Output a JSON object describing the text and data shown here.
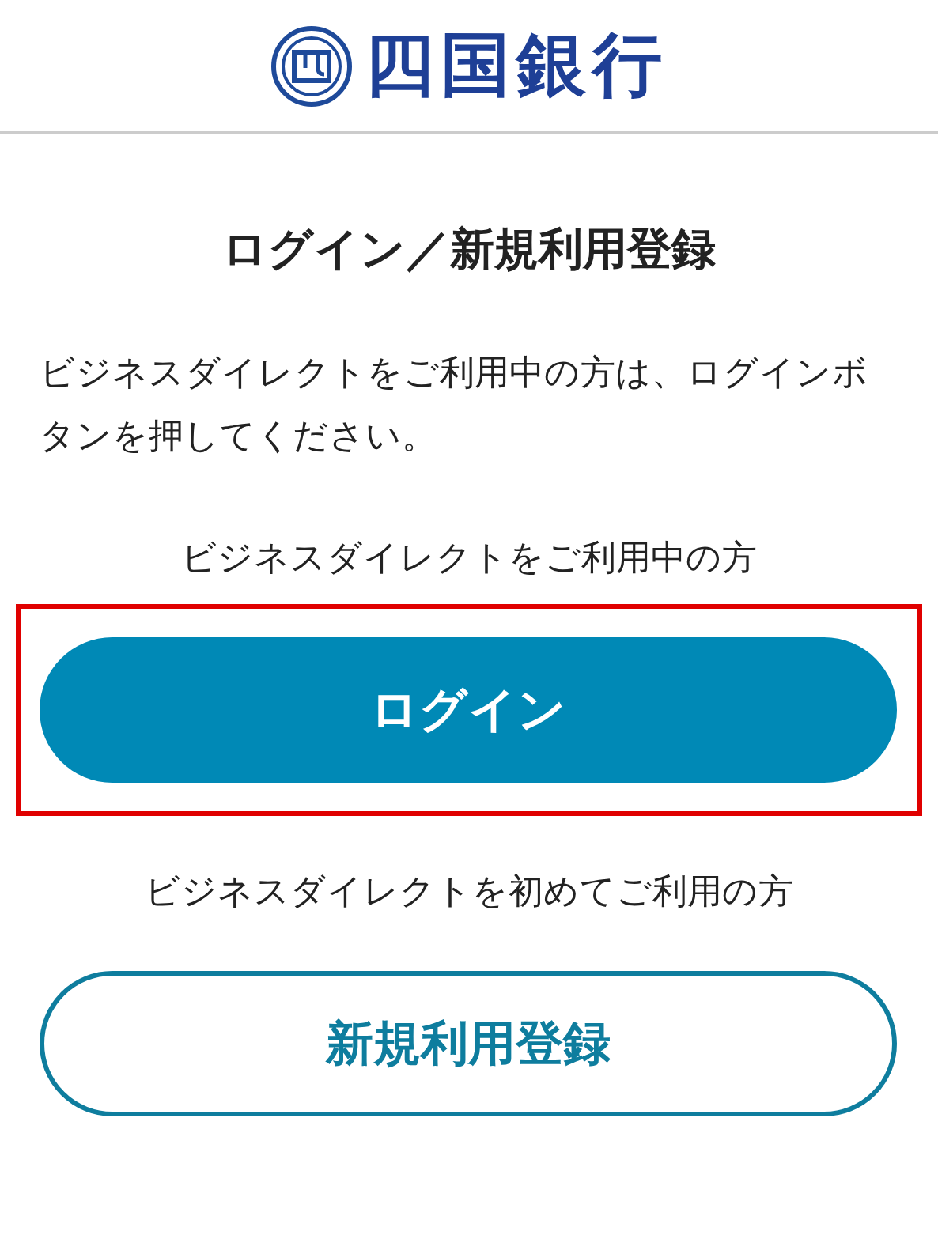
{
  "header": {
    "logo_text": "四国銀行"
  },
  "title": "ログイン／新規利用登録",
  "description": "ビジネスダイレクトをご利用中の方は、ログインボタンを押してください。",
  "sections": [
    {
      "label": "ビジネスダイレクトをご利用中の方",
      "button": "ログイン",
      "kind": "primary",
      "highlighted": true
    },
    {
      "label": "ビジネスダイレクトを初めてご利用の方",
      "button": "新規利用登録",
      "kind": "outline",
      "highlighted": false
    }
  ]
}
